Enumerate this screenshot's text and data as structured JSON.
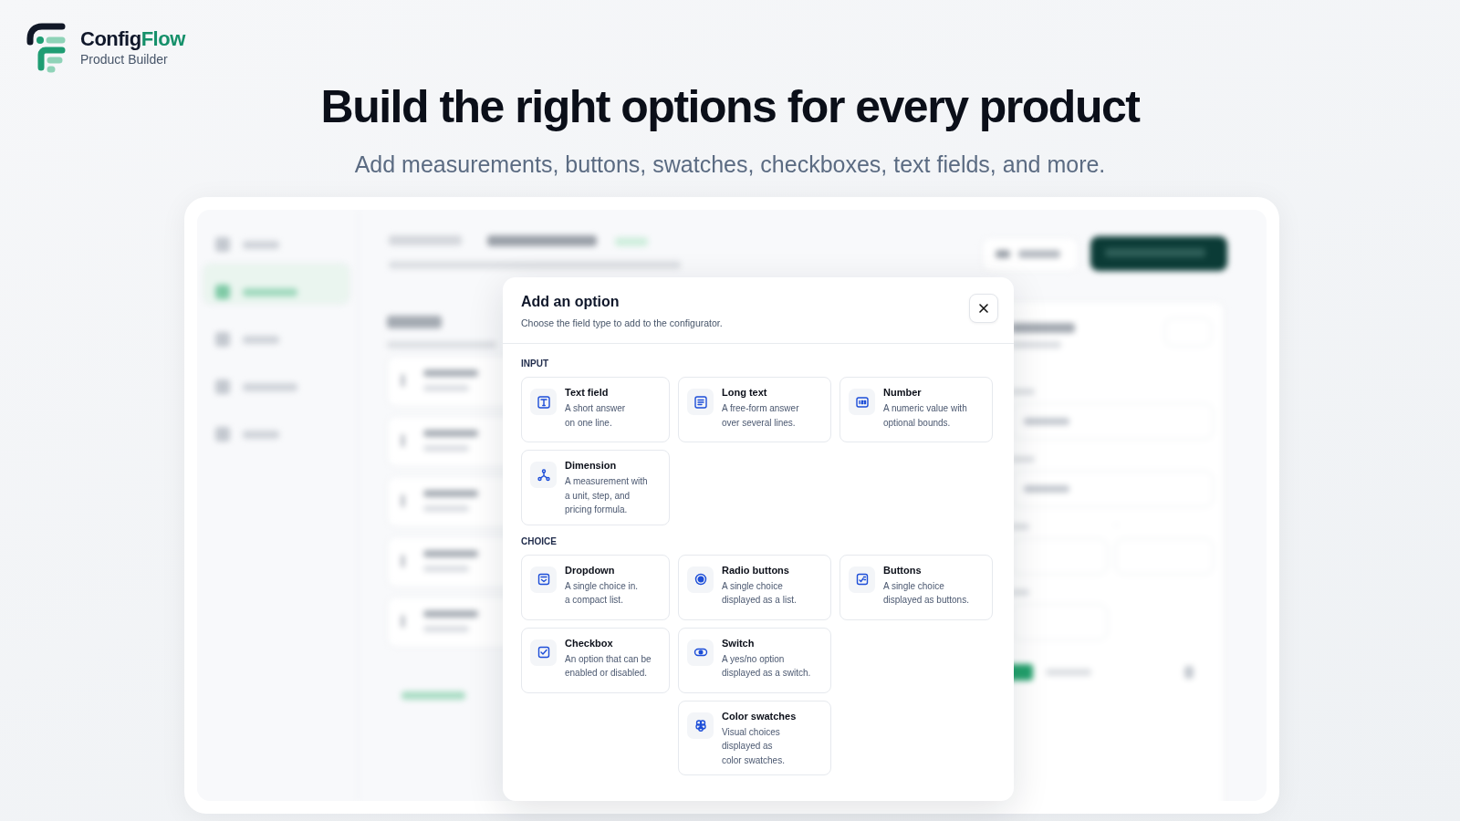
{
  "brand": {
    "name_dark": "Config",
    "name_accent": "Flow",
    "tagline": "Product Builder"
  },
  "hero": {
    "title": "Build the right options for every product",
    "subtitle": "Add measurements, buttons, swatches, checkboxes, text fields, and more."
  },
  "modal": {
    "title": "Add an option",
    "subtitle": "Choose the field type to add to the configurator.",
    "sections": [
      {
        "label": "INPUT",
        "options": [
          {
            "kind": "text",
            "title": "Text field",
            "lines": [
              "A short answer",
              "on one line."
            ]
          },
          {
            "kind": "long_text",
            "title": "Long text",
            "lines": [
              "A free-form answer",
              "over several lines."
            ]
          },
          {
            "kind": "number",
            "title": "Number",
            "lines": [
              "A numeric value with",
              "optional bounds."
            ]
          },
          {
            "kind": "dimension",
            "title": "Dimension",
            "lines": [
              "A measurement with",
              "a unit, step, and",
              "pricing formula."
            ]
          }
        ]
      },
      {
        "label": "CHOICE",
        "options": [
          {
            "kind": "dropdown",
            "title": "Dropdown",
            "lines": [
              "A single choice in.",
              "a compact list."
            ]
          },
          {
            "kind": "radio",
            "title": "Radio buttons",
            "lines": [
              "A single choice",
              "displayed as a list."
            ]
          },
          {
            "kind": "buttons",
            "title": "Buttons",
            "lines": [
              "A single choice",
              "displayed as buttons."
            ]
          },
          {
            "kind": "checkbox",
            "title": "Checkbox",
            "lines": [
              "An option that can be",
              "enabled or disabled."
            ]
          },
          {
            "kind": "switch",
            "title": "Switch",
            "lines": [
              "A yes/no option",
              "displayed as a switch."
            ]
          },
          {
            "kind": "swatches",
            "title": "Color swatches",
            "lines": [
              "Visual choices",
              "displayed as",
              "color swatches."
            ]
          }
        ]
      }
    ]
  }
}
